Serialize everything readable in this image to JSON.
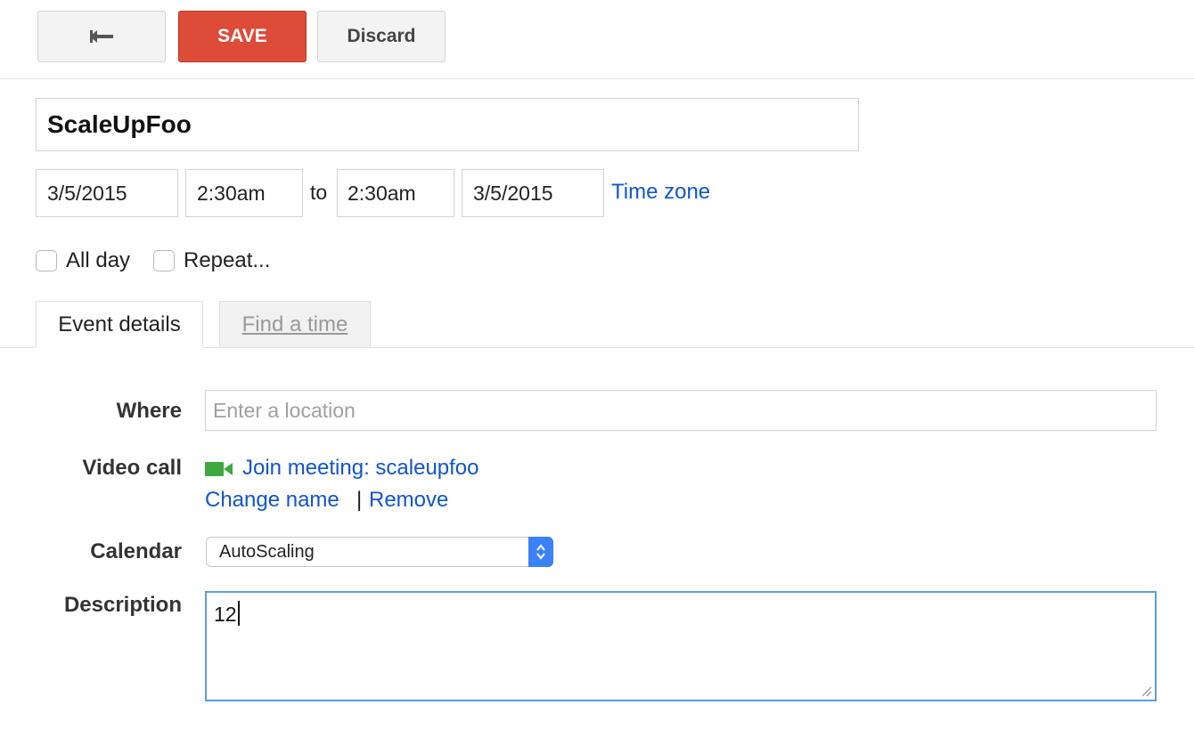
{
  "toolbar": {
    "back_icon": "back-arrow-icon",
    "save_label": "SAVE",
    "discard_label": "Discard",
    "save_color": "#dd4b39"
  },
  "event": {
    "title": "ScaleUpFoo",
    "start_date": "3/5/2015",
    "start_time": "2:30am",
    "to_label": "to",
    "end_time": "2:30am",
    "end_date": "3/5/2015",
    "timezone_link": "Time zone",
    "all_day": {
      "label": "All day",
      "checked": false
    },
    "repeat": {
      "label": "Repeat...",
      "checked": false
    }
  },
  "tabs": [
    {
      "label": "Event details",
      "active": true
    },
    {
      "label": "Find a time",
      "active": false
    }
  ],
  "details": {
    "where_label": "Where",
    "where_placeholder": "Enter a location",
    "video_label": "Video call",
    "video_icon": "video-camera-icon",
    "join_link": "Join meeting: scaleupfoo",
    "change_name_link": "Change name",
    "separator": "|",
    "remove_link": "Remove",
    "calendar_label": "Calendar",
    "calendar_value": "AutoScaling",
    "description_label": "Description",
    "description_value": "12"
  },
  "colors": {
    "link": "#1155cc",
    "accent_blue": "#3b82f6",
    "video_green": "#3ea83e"
  }
}
